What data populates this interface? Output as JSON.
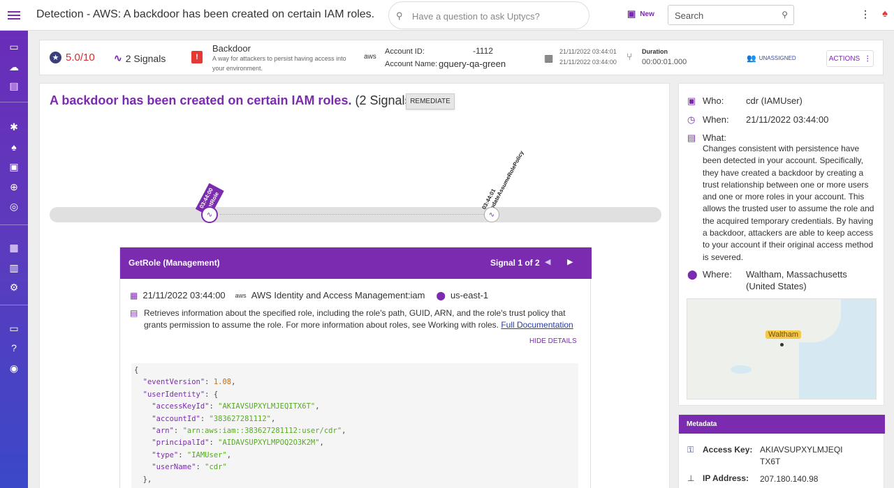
{
  "header": {
    "title": "Detection - AWS: A backdoor has been created on certain IAM roles.",
    "ask_placeholder": "Have a question to ask Uptycs?",
    "new_label": "New",
    "search_placeholder": "Search"
  },
  "summary": {
    "score": "5.0/10",
    "signals": "2 Signals",
    "tactic_name": "Backdoor",
    "tactic_desc": "A way for attackers to persist having access into your environment.",
    "aws_logo": "aws",
    "account_id_label": "Account ID:",
    "account_id_value": "-1112",
    "account_name_label": "Account Name:",
    "account_name_value": "gquery-qa-green",
    "time_start": "21/11/2022 03:44:01",
    "time_end": "21/11/2022 03:44:00",
    "duration_label": "Duration",
    "duration_value": "00:00:01.000",
    "assignee": "UNASSIGNED",
    "actions_label": "ACTIONS"
  },
  "main": {
    "heading_primary": "A backdoor has been created on certain IAM roles.",
    "heading_secondary": "(2 Signals)",
    "remediate_label": "REMEDIATE",
    "timeline": [
      {
        "time": "03:44:00",
        "event": "GetRole"
      },
      {
        "time": "03:44:01",
        "event": "UpdateAssumeRolePolicy"
      }
    ]
  },
  "signal": {
    "title": "GetRole (Management)",
    "counter": "Signal 1 of 2",
    "timestamp": "21/11/2022 03:44:00",
    "aws_logo": "aws",
    "service": "AWS Identity and Access Management:iam",
    "region": "us-east-1",
    "description": "Retrieves information about the specified role, including the role's path, GUID, ARN, and the role's trust policy that grants permission to assume the role. For more information about roles, see Working with roles.",
    "doc_link": "Full Documentation",
    "hide_details": "HIDE DETAILS",
    "json": {
      "open_brace": "{",
      "event_version_key": "\"eventVersion\"",
      "event_version_value": "1.08",
      "user_identity_key": "\"userIdentity\"",
      "access_key_id_key": "\"accessKeyId\"",
      "access_key_id_value": "\"AKIAVSUPXYLMJEQITX6T\"",
      "account_id_key": "\"accountId\"",
      "account_id_value": "\"383627281112\"",
      "arn_key": "\"arn\"",
      "arn_value": "\"arn:aws:iam::383627281112:user/cdr\"",
      "principal_id_key": "\"principalId\"",
      "principal_id_value": "\"AIDAVSUPXYLMPOQ2O3K2M\"",
      "type_key": "\"type\"",
      "type_value": "\"IAMUser\"",
      "user_name_key": "\"userName\"",
      "user_name_value": "\"cdr\""
    }
  },
  "details": {
    "who_label": "Who:",
    "who_value": "cdr (IAMUser)",
    "when_label": "When:",
    "when_value": "21/11/2022 03:44:00",
    "what_label": "What:",
    "what_value": "Changes consistent with persistence have been detected in your account. Specifically, they have created a backdoor by creating a trust relationship between one or more users and one or more roles in your account. This allows the trusted user to assume the role and the acquired temporary credentials. By having a backdoor, attackers are able to keep access to your account if their original access method is severed.",
    "where_label": "Where:",
    "where_value_1": "Waltham, Massachusetts",
    "where_value_2": "(United States)",
    "map_pin": "Waltham"
  },
  "metadata": {
    "title": "Metadata",
    "access_key_label": "Access Key:",
    "access_key_value_1": "AKIAVSUPXYLMJEQI",
    "access_key_value_2": "TX6T",
    "ip_label": "IP Address:",
    "ip_value": "207.180.140.98"
  },
  "colors": {
    "accent": "#7b2bb0",
    "score": "#d32f2f",
    "link": "#2a3ca0"
  }
}
